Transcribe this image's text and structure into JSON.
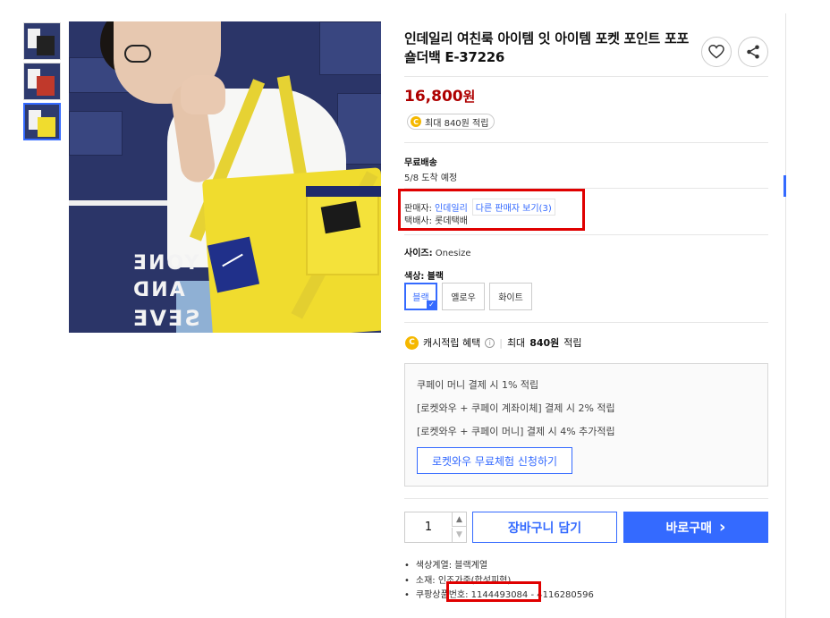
{
  "product": {
    "title": "인데일리 여친룩 아이템 잇 아이템 포켓 포인트 포포숄더백 E-37226",
    "price": "16,800",
    "price_unit": "원",
    "reward_badge": "최대 840원 적립",
    "reward_coin": "C"
  },
  "shipping": {
    "label": "무료배송",
    "arrival": "5/8 도착 예정"
  },
  "seller": {
    "prefix": "판매자:",
    "name": "인데일리",
    "other_sellers": "다른 판매자 보기(3)",
    "courier": "택배사: 롯데택배"
  },
  "options": {
    "size_label": "사이즈:",
    "size_value": "Onesize",
    "color_label": "색상:",
    "color_value": "블랙",
    "colors": [
      "블랙",
      "옐로우",
      "화이트"
    ],
    "selected_check": "✓"
  },
  "cash": {
    "coin": "C",
    "label": "캐시적립 혜택",
    "info": "i",
    "divider": "|",
    "max_prefix": "최대",
    "max_amount": "840원",
    "max_suffix": "적립"
  },
  "benefits": {
    "lines": [
      "쿠페이 머니 결제 시 1% 적립",
      "[로켓와우 + 쿠페이 계좌이체] 결제 시 2% 적립",
      "[로켓와우 + 쿠페이 머니] 결제 시 4% 추가적립"
    ],
    "trial_button": "로켓와우 무료체험 신청하기"
  },
  "purchase": {
    "quantity": "1",
    "qty_up": "▲",
    "qty_down": "▼",
    "cart_button": "장바구니 담기",
    "buy_button": "바로구매",
    "buy_arrow": "›"
  },
  "details": [
    "색상계열: 블랙계열",
    "소재: 인조가죽(합성피혁)",
    "쿠팡상품번호: 1144493084 - 4116280596"
  ],
  "image": {
    "mural_lines": [
      "YONE",
      "AND",
      "SEVE"
    ]
  },
  "colors": {
    "accent": "#346aff",
    "price": "#ae0000",
    "highlight_box": "#e00000",
    "coin": "#f5b800"
  },
  "icons": [
    "heart-icon",
    "share-icon",
    "coin-icon",
    "info-icon",
    "chevron-right-icon",
    "check-icon"
  ]
}
